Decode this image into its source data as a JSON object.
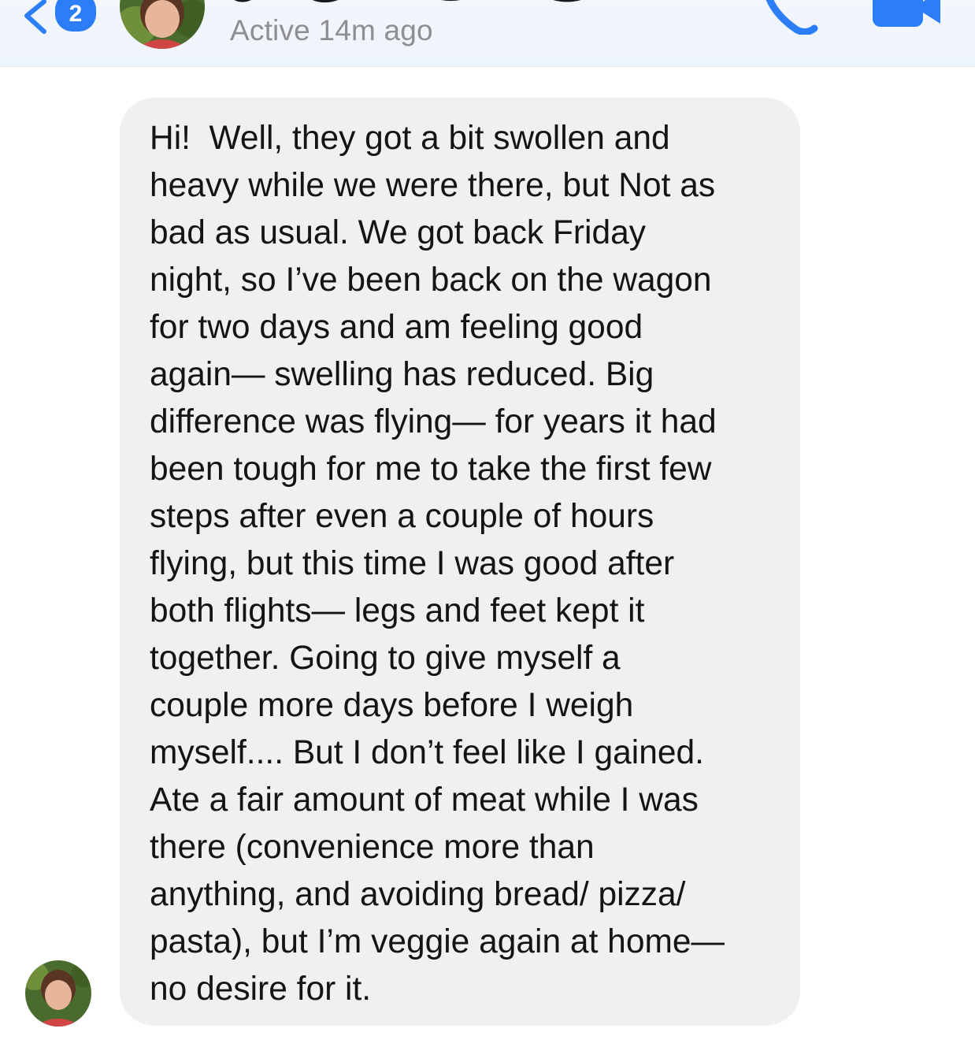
{
  "header": {
    "unread_count": "2",
    "status": "Active 14m ago",
    "icons": {
      "back": "chevron-left-icon",
      "call": "phone-icon",
      "video": "video-camera-icon"
    },
    "accent_color": "#2b7ef6"
  },
  "conversation": {
    "messages": [
      {
        "direction": "incoming",
        "text": "Hi!  Well, they got a bit swollen and\nheavy while we were there, but Not as\nbad as usual. We got back Friday\nnight, so I’ve been back on the wagon\nfor two days and am feeling good\nagain— swelling has reduced. Big\ndifference was flying— for years it had\nbeen tough for me to take the first few\nsteps after even a couple of hours\nflying, but this time I was good after\nboth flights— legs and feet kept it\ntogether. Going to give myself a\ncouple more days before I weigh\nmyself.... But I don’t feel like I gained.\nAte a fair amount of meat while I was\nthere (convenience more than\nanything, and avoiding bread/ pizza/\npasta), but I’m veggie again at home—\nno desire for it."
      }
    ],
    "bubble_color": "#f0f0f0"
  }
}
